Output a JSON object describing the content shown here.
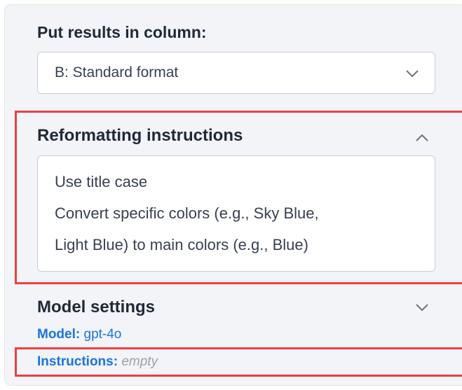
{
  "column_select": {
    "label": "Put results in column:",
    "value": "B: Standard format"
  },
  "reformatting": {
    "title": "Reformatting instructions",
    "lines": [
      "Use title case",
      "Convert specific colors (e.g., Sky Blue,",
      "Light Blue) to main colors (e.g., Blue)"
    ]
  },
  "model_settings": {
    "title": "Model settings",
    "model_key": "Model:",
    "model_value": "gpt-4o",
    "instructions_key": "Instructions:",
    "instructions_value": "empty"
  },
  "icons": {
    "select_chevron": "chevron-down-icon",
    "reformatting_toggle": "chevron-up-icon",
    "model_toggle": "chevron-down-icon"
  },
  "colors": {
    "highlight": "#ef3e42",
    "link": "#1a73e8",
    "panel_bg": "#f2f4f7"
  }
}
